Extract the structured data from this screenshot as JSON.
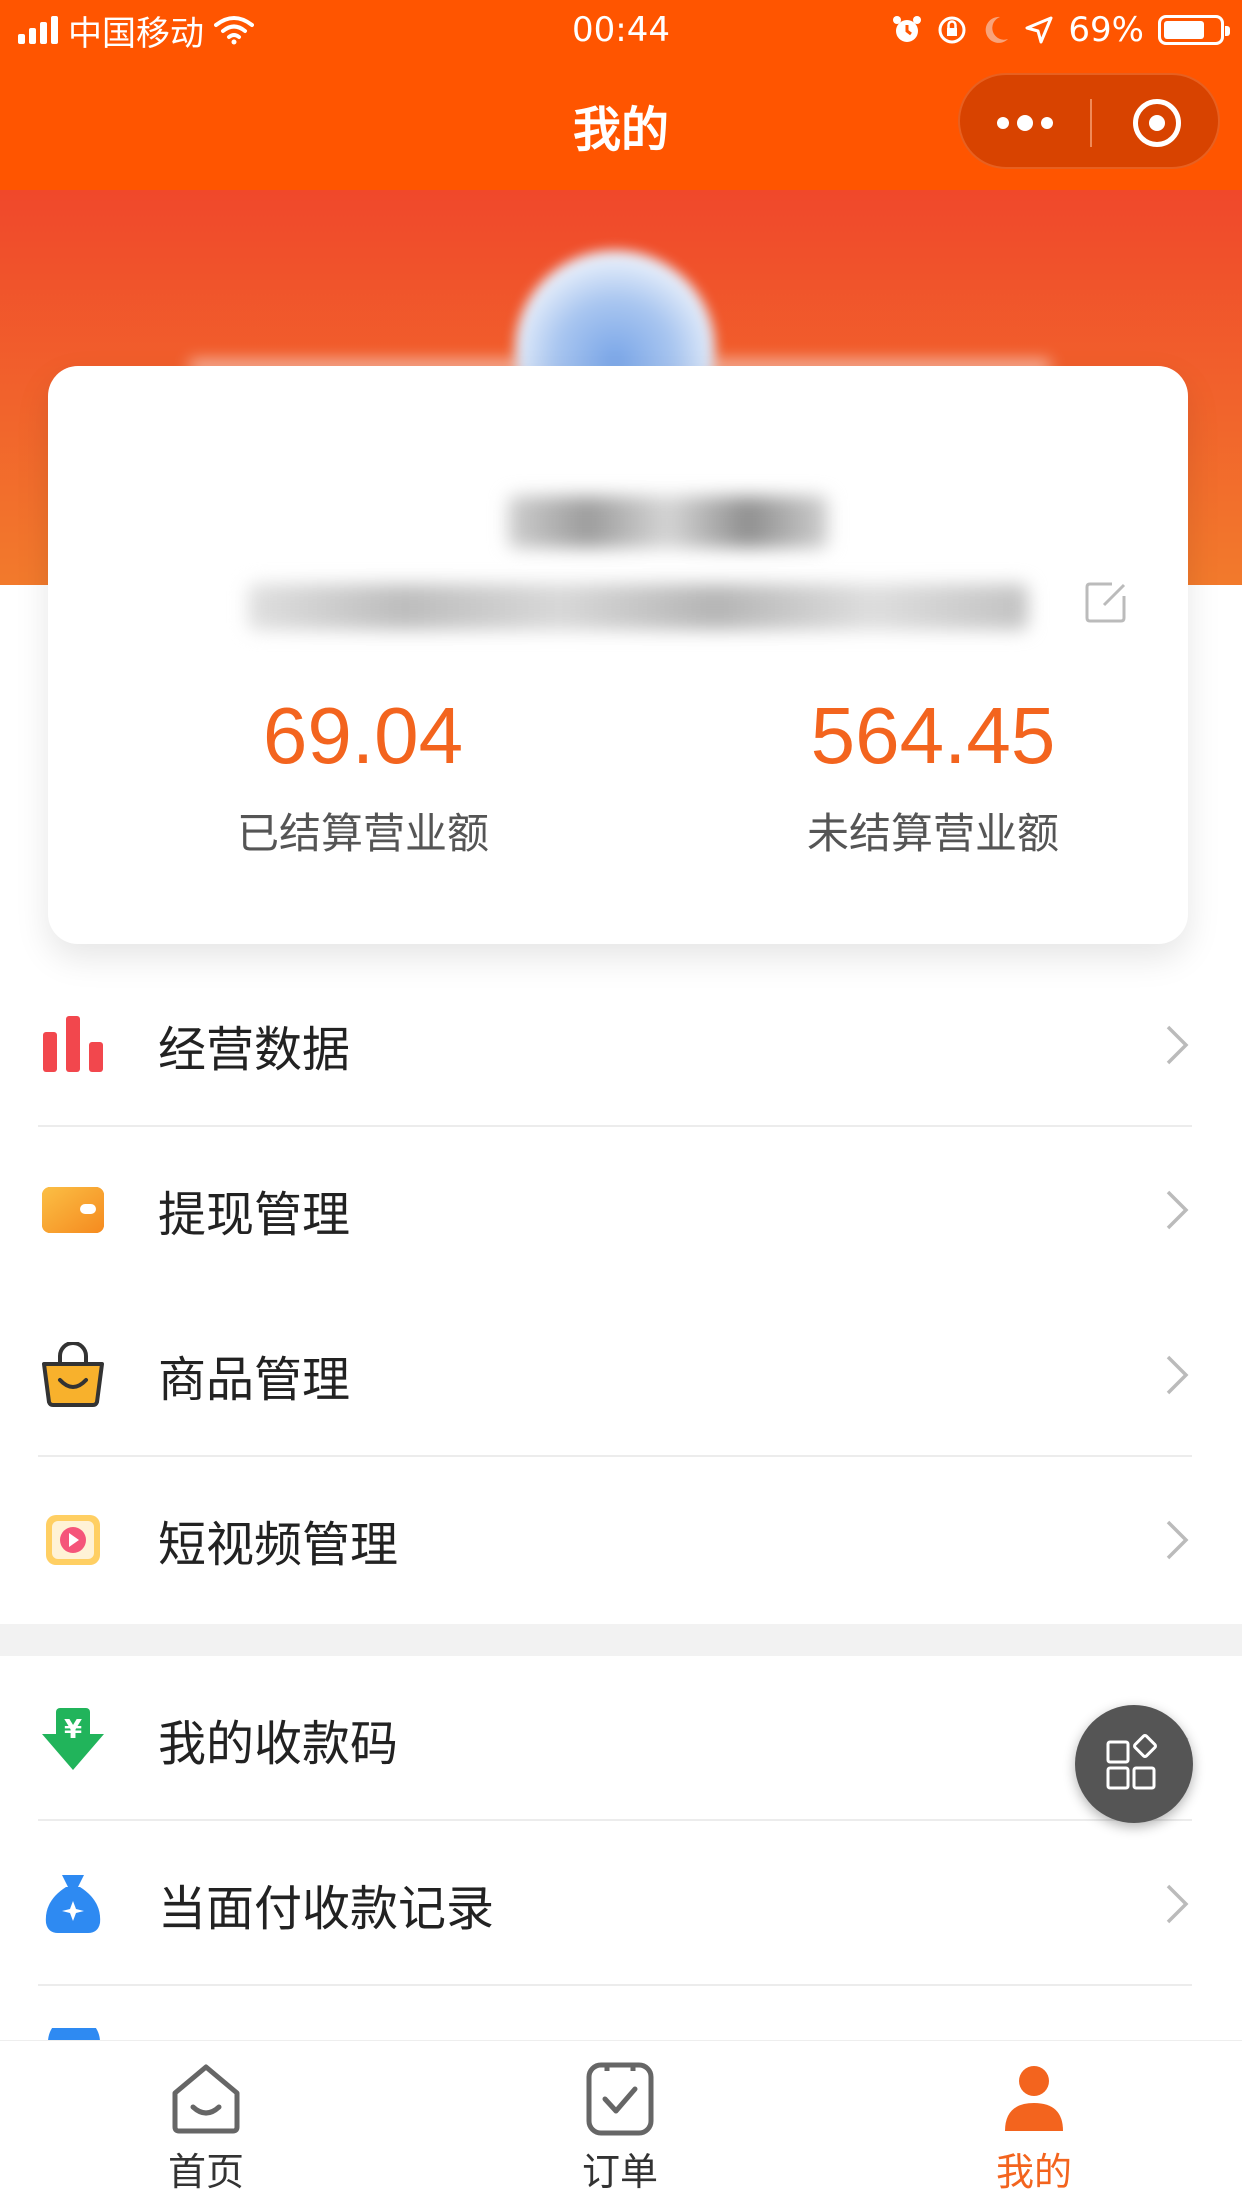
{
  "status_bar": {
    "carrier": "中国移动",
    "time": "00:44",
    "battery": "69%"
  },
  "nav": {
    "title": "我的"
  },
  "profile": {
    "stats": [
      {
        "value": "69.04",
        "label": "已结算营业额"
      },
      {
        "value": "564.45",
        "label": "未结算营业额"
      }
    ]
  },
  "menu": {
    "items": [
      {
        "label": "经营数据",
        "icon": "bar-chart-icon"
      },
      {
        "label": "提现管理",
        "icon": "wallet-icon"
      },
      {
        "label": "商品管理",
        "icon": "shopping-bag-icon"
      },
      {
        "label": "短视频管理",
        "icon": "video-icon"
      },
      {
        "label": "我的收款码",
        "icon": "yuan-download-icon"
      },
      {
        "label": "当面付收款记录",
        "icon": "money-bag-icon"
      }
    ]
  },
  "tabbar": {
    "tabs": [
      {
        "label": "首页",
        "icon": "home-icon"
      },
      {
        "label": "订单",
        "icon": "order-icon"
      },
      {
        "label": "我的",
        "icon": "user-icon",
        "active": true
      }
    ]
  },
  "colors": {
    "brand": "#ff5500",
    "accent": "#f3641e",
    "tab_active": "#f3641e"
  }
}
